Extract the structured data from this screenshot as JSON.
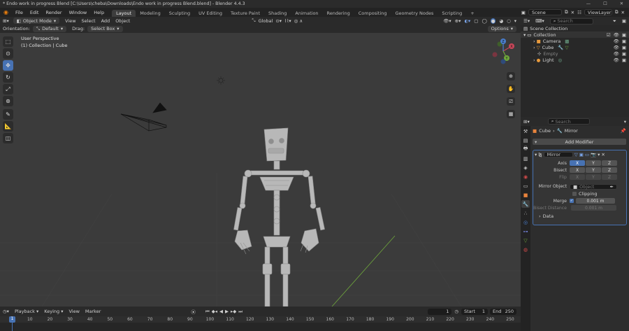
{
  "window": {
    "title": "* Endo work in progress Blend [C:\\Users\\cheba\\Downloads\\Endo work in progress Blend.blend] - Blender 4.4.3"
  },
  "menu": [
    "File",
    "Edit",
    "Render",
    "Window",
    "Help"
  ],
  "workspaces": [
    "Layout",
    "Modeling",
    "Sculpting",
    "UV Editing",
    "Texture Paint",
    "Shading",
    "Animation",
    "Rendering",
    "Compositing",
    "Geometry Nodes",
    "Scripting"
  ],
  "scene": {
    "name": "Scene",
    "view_layer": "ViewLayer"
  },
  "viewport_header": {
    "mode": "Object Mode",
    "menus": [
      "View",
      "Select",
      "Add",
      "Object"
    ],
    "transform": "Global",
    "orientation_label": "Orientation:",
    "orientation_value": "Default",
    "drag_label": "Drag:",
    "drag_value": "Select Box",
    "options": "Options"
  },
  "viewport": {
    "perspective": "User Perspective",
    "context": "(1) Collection | Cube"
  },
  "gizmo": {
    "x": "X",
    "y": "Y",
    "z": "Z"
  },
  "timeline": {
    "menus": [
      "Playback",
      "Keying",
      "View",
      "Marker"
    ],
    "current_frame": "1",
    "start_label": "Start",
    "start": "1",
    "end_label": "End",
    "end": "250",
    "ruler": [
      "1",
      "10",
      "20",
      "30",
      "40",
      "50",
      "60",
      "70",
      "80",
      "90",
      "100",
      "110",
      "120",
      "130",
      "140",
      "150",
      "160",
      "170",
      "180",
      "190",
      "200",
      "210",
      "220",
      "230",
      "240",
      "250"
    ]
  },
  "outliner": {
    "search_placeholder": "Search",
    "scene_collection": "Scene Collection",
    "collection": "Collection",
    "items": [
      {
        "name": "Camera",
        "color": "#e89a3c"
      },
      {
        "name": "Cube",
        "color": "#e89a3c"
      },
      {
        "name": "Empty",
        "color": "#9a9a9a"
      },
      {
        "name": "Light",
        "color": "#e89a3c"
      }
    ]
  },
  "properties": {
    "search_placeholder": "Search",
    "breadcrumb_object": "Cube",
    "breadcrumb_modifier": "Mirror",
    "add_modifier": "Add Modifier",
    "modifier_name": "Mirror",
    "axis_label": "Axis",
    "bisect_label": "Bisect",
    "flip_label": "Flip",
    "axes": [
      "X",
      "Y",
      "Z"
    ],
    "mirror_object_label": "Mirror Object",
    "object_placeholder": "Object",
    "clipping_label": "Clipping",
    "merge_label": "Merge",
    "merge_value": "0.001 m",
    "bisect_distance_label": "Bisect Distance",
    "bisect_distance_value": "0.001 m",
    "data_label": "Data"
  },
  "colors": {
    "accent": "#4772b3",
    "viewport_bg": "#3b3b3b",
    "axis_x": "#c8475a",
    "axis_y": "#6fa83c",
    "axis_z": "#4a7fcf"
  }
}
